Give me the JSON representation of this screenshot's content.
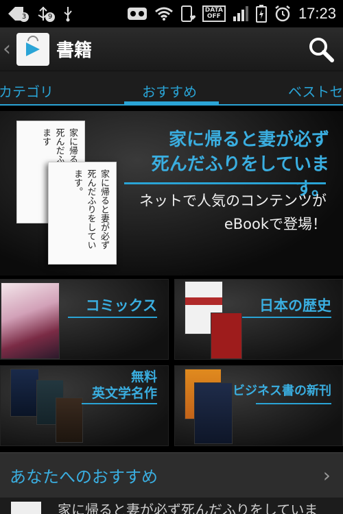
{
  "status_bar": {
    "notification_count": "3",
    "usb_badge": "9",
    "data_label_top": "DATA",
    "data_label_bottom": "OFF",
    "time": "17:23",
    "icons": [
      "notification-icon",
      "usb-debug-icon",
      "usb-icon",
      "voicemail-icon",
      "wifi-icon",
      "phone-heart-icon",
      "data-off-icon",
      "signal-icon",
      "battery-icon",
      "alarm-icon"
    ]
  },
  "action_bar": {
    "title": "書籍",
    "icons": [
      "back-chevron-icon",
      "play-store-icon",
      "search-icon"
    ]
  },
  "tabs": [
    {
      "label": "カテゴリ"
    },
    {
      "label": "おすすめ",
      "active": true
    },
    {
      "label": "ベストセ"
    }
  ],
  "banner": {
    "headline_1": "家に帰ると妻が必ず",
    "headline_2": "死んだふりをしています。",
    "sub_1": "ネットで人気のコンテンツが",
    "sub_2": "eBookで登場！",
    "book_front_text": "家に帰ると妻が必ず死んだふりをしています。",
    "book_back_text": "家に帰ると妻が必ず死んだふりをしています"
  },
  "categories": [
    {
      "label": "コミックス"
    },
    {
      "label": "日本の歴史"
    },
    {
      "label_1": "無料",
      "label_2": "英文学名作"
    },
    {
      "label": "ビジネス書の新刊"
    }
  ],
  "recommendations": {
    "title": "あなたへのおすすめ",
    "first_item": "家に帰ると妻が必ず死んだふりをしていま"
  },
  "colors": {
    "accent": "#2aa4d6",
    "background": "#000000"
  }
}
